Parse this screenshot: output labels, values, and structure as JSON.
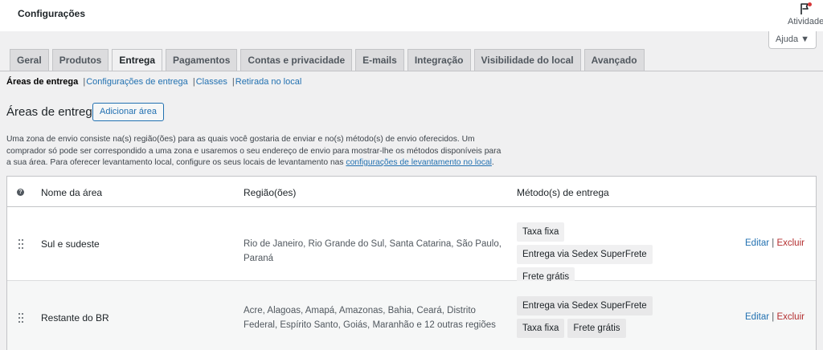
{
  "header": {
    "title": "Configurações",
    "activity_label": "Atividade"
  },
  "help": {
    "label": "Ajuda ▼"
  },
  "tabs": [
    {
      "label": "Geral"
    },
    {
      "label": "Produtos"
    },
    {
      "label": "Entrega"
    },
    {
      "label": "Pagamentos"
    },
    {
      "label": "Contas e privacidade"
    },
    {
      "label": "E-mails"
    },
    {
      "label": "Integração"
    },
    {
      "label": "Visibilidade do local"
    },
    {
      "label": "Avançado"
    }
  ],
  "subnav": {
    "current": "Áreas de entrega",
    "links": [
      "Configurações de entrega",
      "Classes",
      "Retirada no local"
    ]
  },
  "section": {
    "title": "Áreas de entrega",
    "add_button": "Adicionar área",
    "description_1": "Uma zona de envio consiste na(s) região(ões) para as quais você gostaria de enviar e no(s) método(s) de envio oferecidos. Um comprador só pode ser correspondido a uma zona e usaremos o seu endereço de envio para mostrar-lhe os métodos disponíveis para a sua área. Para oferecer levantamento local, configure os seus locais de levantamento nas ",
    "description_link": "configurações de levantamento no local",
    "description_2": "."
  },
  "table": {
    "help_icon": "?",
    "columns": {
      "name": "Nome da área",
      "regions": "Região(ões)",
      "methods": "Método(s) de entrega"
    },
    "rows": [
      {
        "name": "Sul e sudeste",
        "regions": "Rio de Janeiro, Rio Grande do Sul, Santa Catarina, São Paulo, Paraná",
        "methods": [
          "Taxa fixa",
          "Entrega via Sedex SuperFrete",
          "Frete grátis"
        ],
        "edit": "Editar",
        "pipe": "|",
        "delete": "Excluir"
      },
      {
        "name": "Restante do BR",
        "regions": "Acre, Alagoas, Amapá, Amazonas, Bahia, Ceará, Distrito Federal, Espírito Santo, Goiás, Maranhão e 12 outras regiões",
        "methods": [
          "Entrega via Sedex SuperFrete",
          "Taxa fixa",
          "Frete grátis"
        ],
        "edit": "Editar",
        "pipe": "|",
        "delete": "Excluir"
      }
    ]
  },
  "colors": {
    "link": "#2271b1",
    "delete": "#b32d2e",
    "notification_dot": "#d63638"
  }
}
